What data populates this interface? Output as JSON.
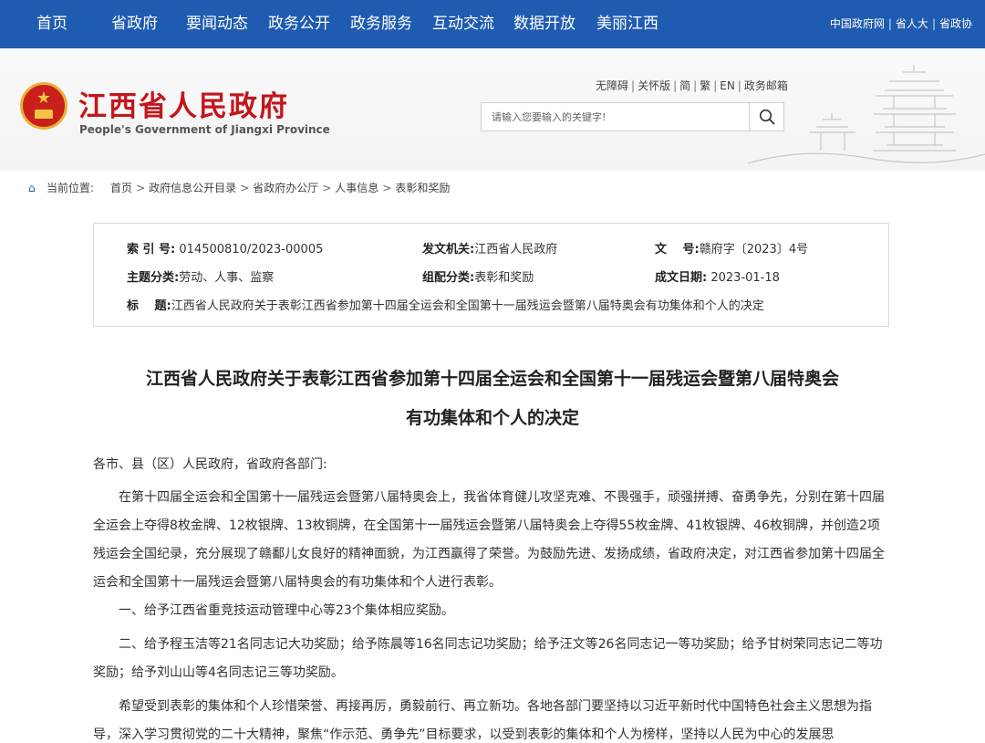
{
  "nav": {
    "items": [
      "首页",
      "省政府",
      "要闻动态",
      "政务公开",
      "政务服务",
      "互动交流",
      "数据开放",
      "美丽江西"
    ],
    "right_links": [
      "中国政府网",
      "省人大",
      "省政协"
    ]
  },
  "header": {
    "title": "江西省人民政府",
    "subtitle": "People's Government of Jiangxi Province",
    "tools": [
      "无障碍",
      "关怀版",
      "简",
      "繁",
      "EN",
      "政务邮箱"
    ],
    "search_placeholder": "请输入您要输入的关键字!"
  },
  "breadcrumb": {
    "label": "当前位置:",
    "items": [
      "首页",
      "政府信息公开目录",
      "省政府办公厅",
      "人事信息",
      "表彰和奖励"
    ]
  },
  "info": {
    "index_label": "索 引 号:",
    "index_value": "014500810/2023-00005",
    "issuer_label": "发文机关:",
    "issuer_value": "江西省人民政府",
    "docno_label": "文　 号:",
    "docno_value": "赣府字〔2023〕4号",
    "topic_label": "主题分类:",
    "topic_value": "劳动、人事、监察",
    "category_label": "组配分类:",
    "category_value": "表彰和奖励",
    "date_label": "成文日期:",
    "date_value": "2023-01-18",
    "title_label": "标　 题:",
    "title_value": "江西省人民政府关于表彰江西省参加第十四届全运会和全国第十一届残运会暨第八届特奥会有功集体和个人的决定"
  },
  "article": {
    "title_line1": "江西省人民政府关于表彰江西省参加第十四届全运会和全国第十一届残运会暨第八届特奥会",
    "title_line2": "有功集体和个人的决定",
    "salutation": "各市、县（区）人民政府，省政府各部门:",
    "p1": "在第十四届全运会和全国第十一届残运会暨第八届特奥会上，我省体育健儿攻坚克难、不畏强手，顽强拼搏、奋勇争先，分别在第十四届全运会上夺得8枚金牌、12枚银牌、13枚铜牌，在全国第十一届残运会暨第八届特奥会上夺得55枚金牌、41枚银牌、46枚铜牌，并创造2项残运会全国纪录，充分展现了赣鄱儿女良好的精神面貌，为江西赢得了荣誉。为鼓励先进、发扬成绩，省政府决定，对江西省参加第十四届全运会和全国第十一届残运会暨第八届特奥会的有功集体和个人进行表彰。",
    "p2": "一、给予江西省重竞技运动管理中心等23个集体相应奖励。",
    "p3": "二、给予程玉洁等21名同志记大功奖励；给予陈晨等16名同志记功奖励；给予汪文等26名同志记一等功奖励；给予甘树荣同志记二等功奖励；给予刘山山等4名同志记三等功奖励。",
    "p4": "希望受到表彰的集体和个人珍惜荣誉、再接再厉，勇毅前行、再立新功。各地各部门要坚持以习近平新时代中国特色社会主义思想为指导，深入学习贯彻党的二十大精神，聚焦“作示范、勇争先”目标要求，以受到表彰的集体和个人为榜样，坚持以人民为中心的发展思"
  },
  "colors": {
    "nav_bg": "#1f5bb0",
    "title_red": "#c3161c"
  }
}
